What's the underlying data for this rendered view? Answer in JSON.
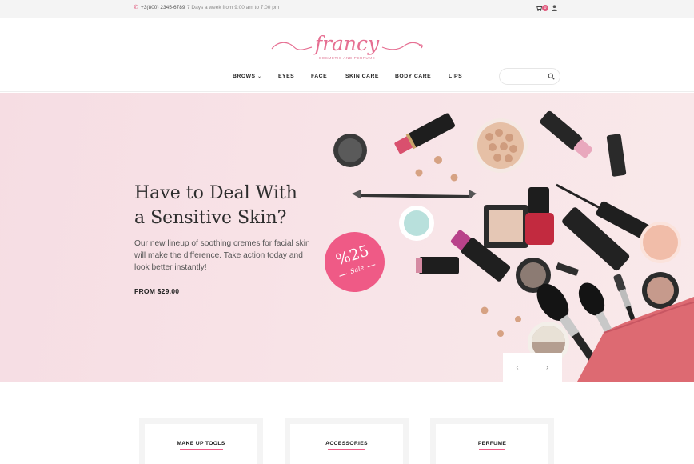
{
  "topbar": {
    "phone": "+3(800) 2345-6789",
    "hours": "7 Days a week from 9:00 am to 7:00 pm",
    "cart_count": "0",
    "icons": [
      "phone-icon",
      "cart-icon",
      "user-icon"
    ]
  },
  "brand": {
    "name": "francy",
    "tagline": "COSMETIC AND PERFUME",
    "accent": "#e05a7e"
  },
  "nav": {
    "items": [
      {
        "label": "BROWS",
        "has_dropdown": true
      },
      {
        "label": "EYES"
      },
      {
        "label": "FACE"
      },
      {
        "label": "SKIN CARE"
      },
      {
        "label": "BODY CARE"
      },
      {
        "label": "LIPS"
      }
    ]
  },
  "search": {
    "placeholder": ""
  },
  "hero": {
    "title_line1": "Have to Deal With",
    "title_line2": "a Sensitive Skin?",
    "description": "Our new lineup of soothing cremes for facial skin will make the difference. Take action today and look better instantly!",
    "price": "FROM $29.00",
    "sale_percent": "%25",
    "sale_label": "Sale",
    "prev_arrow": "‹",
    "next_arrow": "›"
  },
  "categories": [
    {
      "label": "MAKE UP TOOLS"
    },
    {
      "label": "ACCESSORIES"
    },
    {
      "label": "PERFUME"
    }
  ]
}
